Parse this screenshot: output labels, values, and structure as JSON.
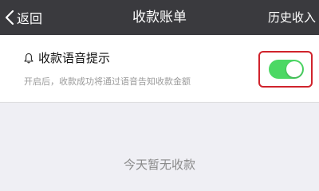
{
  "header": {
    "back_label": "返回",
    "title": "收款账单",
    "history_label": "历史收入"
  },
  "voice_setting": {
    "icon": "bell-icon",
    "title": "收款语音提示",
    "description": "开启后，收款成功将通过语音告知收款金额",
    "enabled": true,
    "toggle_color": "#4cd864",
    "highlight_color": "#d0232c"
  },
  "empty_state": {
    "message": "今天暂无收款"
  },
  "colors": {
    "header_bg": "#3a3a3e",
    "page_bg": "#efeff4"
  }
}
